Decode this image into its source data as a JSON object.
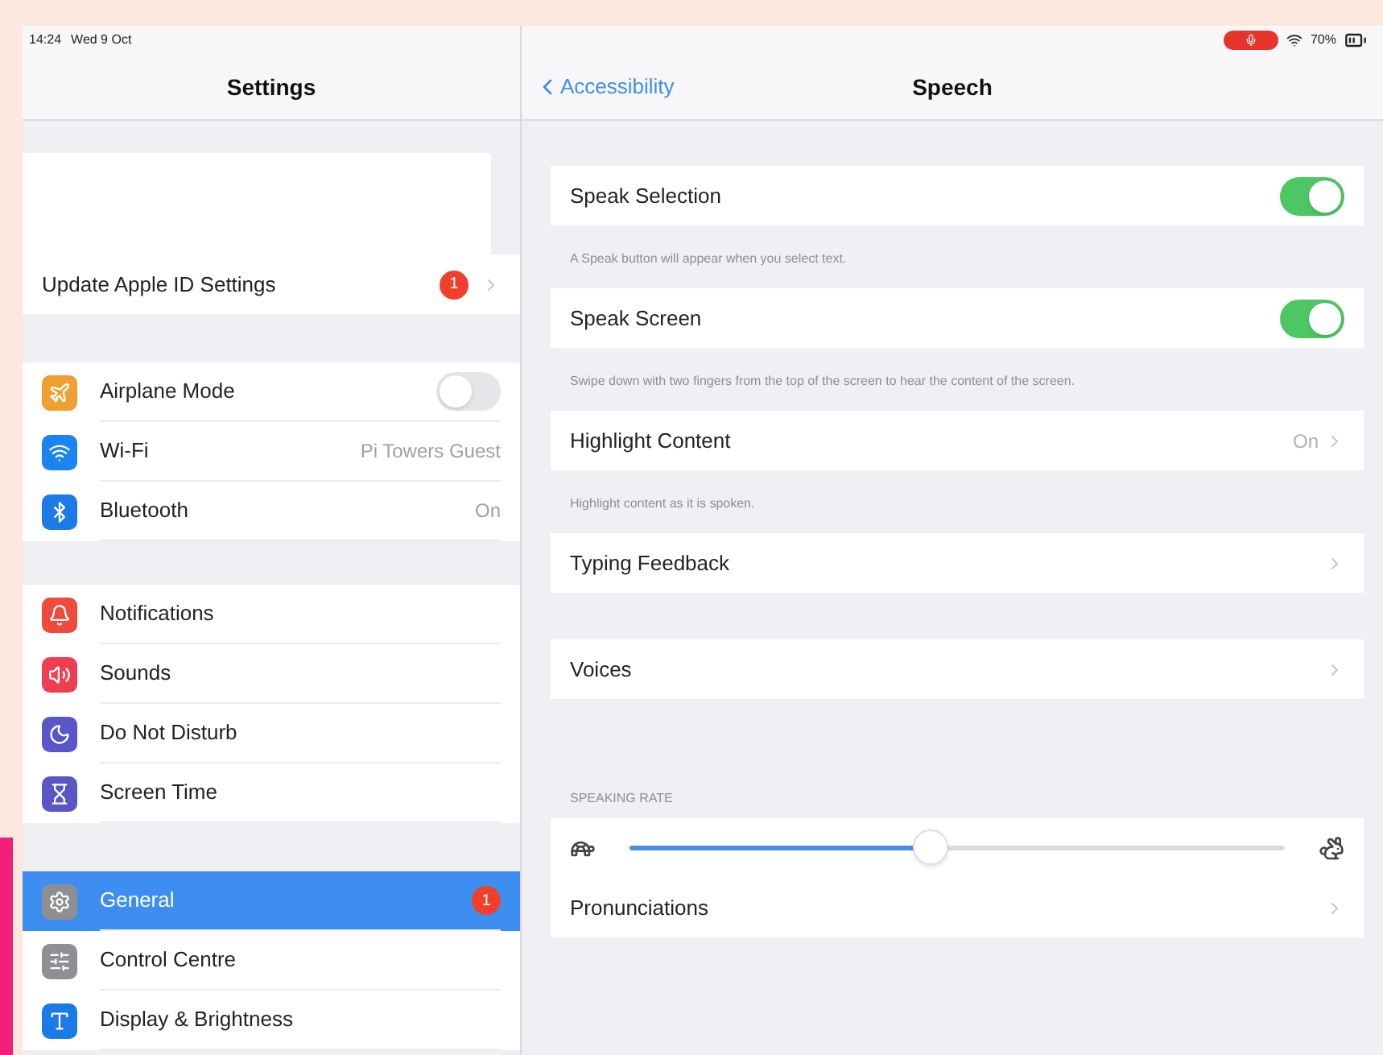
{
  "status_bar": {
    "time": "14:24",
    "date": "Wed 9 Oct",
    "battery": "70%"
  },
  "sidebar": {
    "title": "Settings",
    "account_row": {
      "label": "Update Apple ID Settings",
      "badge": "1"
    },
    "groups": [
      [
        {
          "label": "Airplane Mode",
          "color": "#f0a030",
          "kind": "toggle",
          "on": false,
          "selected": false
        },
        {
          "label": "Wi-Fi",
          "color": "#1a84f0",
          "kind": "value",
          "value": "Pi Towers Guest",
          "selected": false
        },
        {
          "label": "Bluetooth",
          "color": "#1a7ae8",
          "kind": "value",
          "value": "On",
          "selected": false
        }
      ],
      [
        {
          "label": "Notifications",
          "color": "#f04a3c",
          "kind": "plain",
          "selected": false
        },
        {
          "label": "Sounds",
          "color": "#ee3e52",
          "kind": "plain",
          "selected": false
        },
        {
          "label": "Do Not Disturb",
          "color": "#5856c8",
          "kind": "plain",
          "selected": false
        },
        {
          "label": "Screen Time",
          "color": "#5a56c6",
          "kind": "plain",
          "selected": false
        }
      ],
      [
        {
          "label": "General",
          "color": "#8e8e93",
          "kind": "badge",
          "badge": "1",
          "selected": true
        },
        {
          "label": "Control Centre",
          "color": "#8e8e93",
          "kind": "plain",
          "selected": false
        },
        {
          "label": "Display & Brightness",
          "color": "#1a7ae8",
          "kind": "plain",
          "selected": false
        }
      ]
    ]
  },
  "detail": {
    "back": "Accessibility",
    "title": "Speech",
    "items": [
      {
        "kind": "toggle",
        "label": "Speak Selection",
        "on": true,
        "footer": "A Speak button will appear when you select text."
      },
      {
        "kind": "toggle",
        "label": "Speak Screen",
        "on": true,
        "footer": "Swipe down with two fingers from the top of the screen to hear the content of the screen."
      },
      {
        "kind": "link",
        "label": "Highlight Content",
        "value": "On",
        "footer": "Highlight content as it is spoken."
      },
      {
        "kind": "link",
        "label": "Typing Feedback"
      },
      {
        "kind": "link",
        "label": "Voices"
      },
      {
        "kind": "slider",
        "header": "SPEAKING RATE",
        "level": 0.46
      },
      {
        "kind": "link",
        "label": "Pronunciations"
      }
    ]
  }
}
